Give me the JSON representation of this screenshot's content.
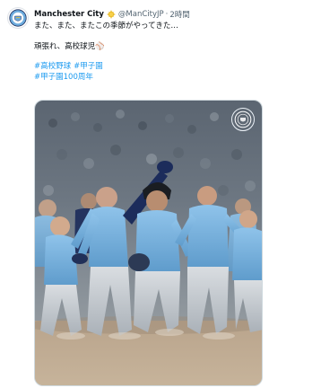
{
  "tweet": {
    "author": {
      "display_name": "Manchester City",
      "handle": "@ManCityJP",
      "separator": "·",
      "time": "2時間",
      "avatar_icon": "man-city-crest-icon",
      "verified_icon": "verified-sun-badge-icon"
    },
    "text_lines": [
      "また、また、またこの季節がやってきた…",
      "頑張れ、高校球児⚾"
    ],
    "hashtags_line1": [
      "#高校野球",
      "#甲子園"
    ],
    "hashtags_line2": [
      "#甲子園100周年"
    ],
    "media": {
      "badge_icon": "man-city-crest-icon"
    }
  },
  "colors": {
    "text": "#0f1419",
    "secondary": "#536471",
    "link": "#1d9bf0",
    "city_blue": "#6cabdd",
    "navy": "#1c2c5b"
  }
}
